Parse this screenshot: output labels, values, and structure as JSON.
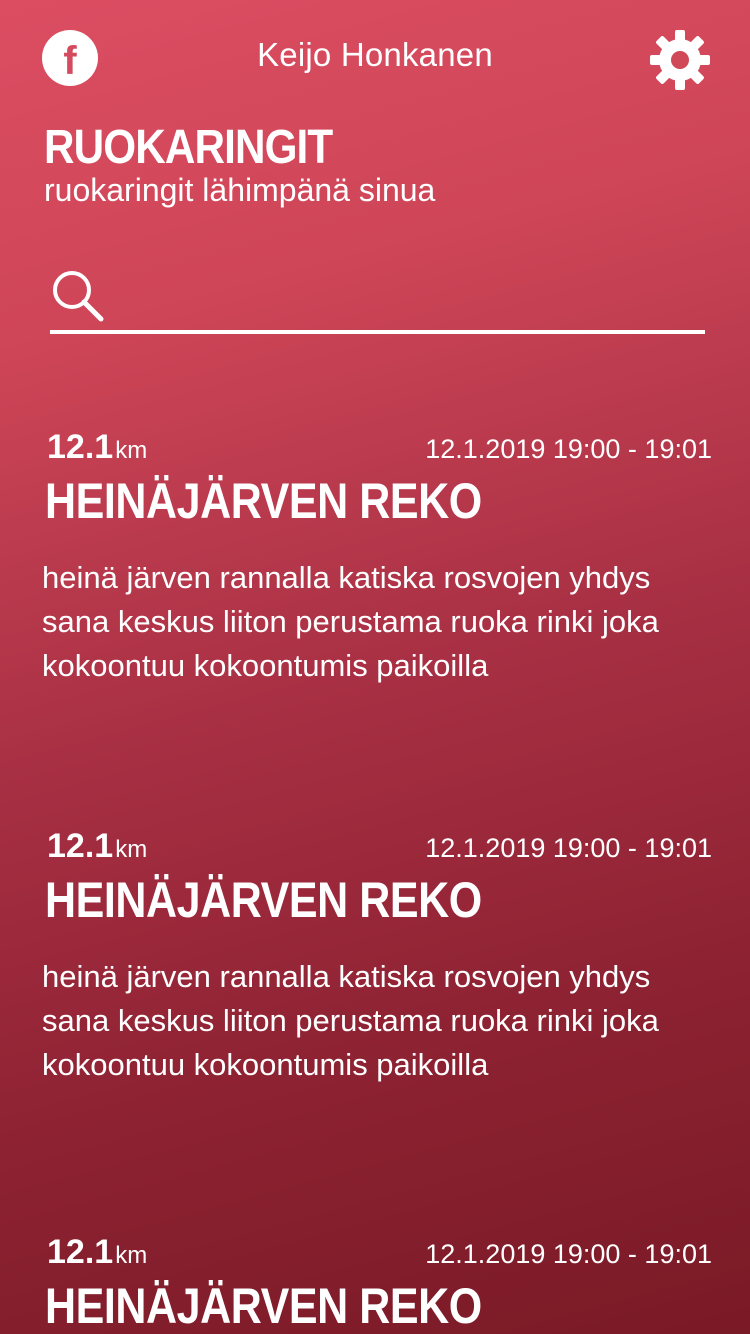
{
  "header": {
    "user_name": "Keijo Honkanen",
    "facebook_icon_glyph": "f",
    "settings_icon": "gear-icon",
    "profile_icon": "facebook-icon"
  },
  "app": {
    "title": "RUOKARINGIT",
    "subtitle": "ruokaringit lähimpänä sinua"
  },
  "search": {
    "icon": "search-icon",
    "value": "",
    "placeholder": ""
  },
  "events": [
    {
      "distance": "12.1",
      "unit": "km",
      "datetime": "12.1.2019 19:00 - 19:01",
      "title": "HEINÄJÄRVEN REKO",
      "description": "heinä järven rannalla katiska rosvojen yhdys sana keskus liiton perustama ruoka rinki joka kokoontuu kokoontumis paikoilla"
    },
    {
      "distance": "12.1",
      "unit": "km",
      "datetime": "12.1.2019 19:00 - 19:01",
      "title": "HEINÄJÄRVEN REKO",
      "description": "heinä järven rannalla katiska rosvojen yhdys sana keskus liiton perustama ruoka rinki joka kokoontuu kokoontumis paikoilla"
    },
    {
      "distance": "12.1",
      "unit": "km",
      "datetime": "12.1.2019 19:00 - 19:01",
      "title": "HEINÄJÄRVEN REKO",
      "description": ""
    }
  ],
  "colors": {
    "gradient_top": "#dc4d62",
    "gradient_bottom": "#7a1a26",
    "foreground": "#ffffff"
  }
}
